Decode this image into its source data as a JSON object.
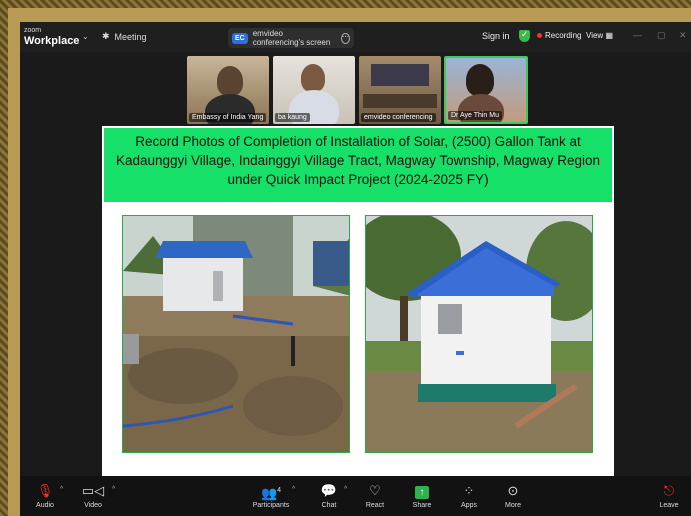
{
  "titlebar": {
    "brand_small": "zoom",
    "brand_large": "Workplace",
    "meeting_label": "Meeting",
    "share_badge": "EC",
    "share_text": "emvideo conferencing's screen",
    "sign_in": "Sign in",
    "recording": "Recording",
    "view": "View"
  },
  "participants": [
    {
      "name": "Embassy of India Yang"
    },
    {
      "name": "ba kaung"
    },
    {
      "name": "emvideo conferencing"
    },
    {
      "name": "Dr Aye Thin Mu"
    }
  ],
  "slide": {
    "title": "Record Photos of Completion of Installation of Solar, (2500) Gallon Tank at Kadaunggyi Village, Indainggyi Village Tract, Magway Township, Magway Region under Quick Impact Project (2024-2025 FY)"
  },
  "toolbar": {
    "audio": "Audio",
    "video": "Video",
    "participants": "Participants",
    "participants_count": "4",
    "chat": "Chat",
    "react": "React",
    "share": "Share",
    "apps": "Apps",
    "more": "More",
    "leave": "Leave"
  },
  "colors": {
    "slide_title_bg": "#16e068",
    "share_green": "#2db24e",
    "active_speaker": "#3ec95a"
  }
}
